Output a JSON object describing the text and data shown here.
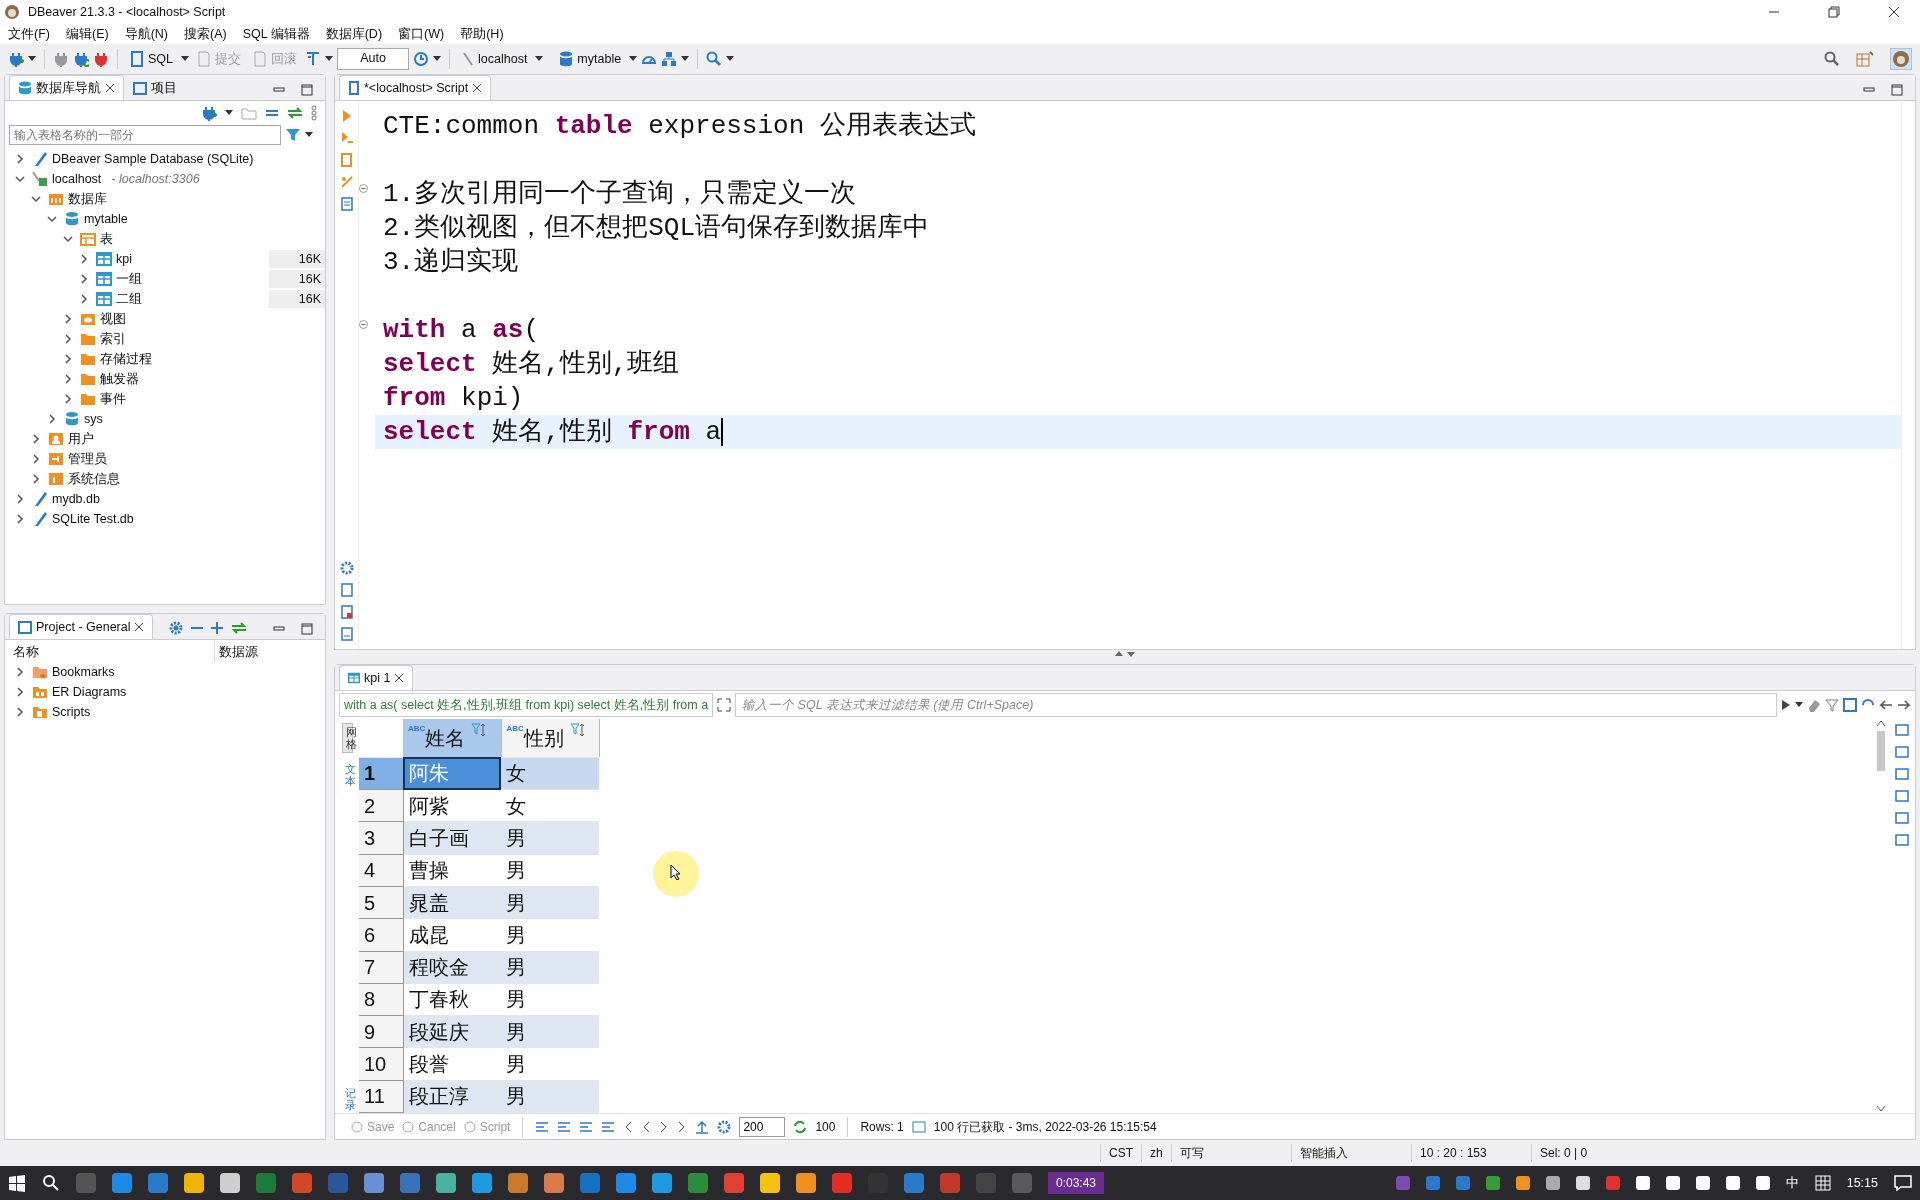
{
  "window": {
    "title": "DBeaver 21.3.3 - <localhost> Script"
  },
  "menu": [
    "文件(F)",
    "编辑(E)",
    "导航(N)",
    "搜索(A)",
    "SQL 编辑器",
    "数据库(D)",
    "窗口(W)",
    "帮助(H)"
  ],
  "toolbar": {
    "sql": "SQL",
    "commit": {
      "label": "提交",
      "disabled": true
    },
    "rollback": {
      "label": "回滚",
      "disabled": true
    },
    "mode": "Auto",
    "connection": "localhost",
    "schema": "mytable"
  },
  "navigator": {
    "tabs": [
      {
        "label": "数据库导航",
        "selected": true
      },
      {
        "label": "项目",
        "selected": false
      }
    ],
    "filter": {
      "placeholder": "输入表格名称的一部分"
    },
    "tree": [
      {
        "label": "DBeaver Sample Database (SQLite)",
        "kind": "sqlite",
        "expanded": false
      },
      {
        "label": "localhost",
        "detail": "- localhost:3306",
        "kind": "connection",
        "expanded": true,
        "children": [
          {
            "label": "数据库",
            "kind": "dbfolder",
            "expanded": true,
            "children": [
              {
                "label": "mytable",
                "kind": "database",
                "expanded": true,
                "children": [
                  {
                    "label": "表",
                    "kind": "tables",
                    "expanded": true,
                    "children": [
                      {
                        "label": "kpi",
                        "kind": "table",
                        "expanded": false,
                        "size": "16K"
                      },
                      {
                        "label": "一组",
                        "kind": "table",
                        "expanded": false,
                        "size": "16K"
                      },
                      {
                        "label": "二组",
                        "kind": "table",
                        "expanded": false,
                        "size": "16K"
                      }
                    ]
                  },
                  {
                    "label": "视图",
                    "kind": "view",
                    "expanded": false
                  },
                  {
                    "label": "索引",
                    "kind": "folder",
                    "expanded": false
                  },
                  {
                    "label": "存储过程",
                    "kind": "folder",
                    "expanded": false
                  },
                  {
                    "label": "触发器",
                    "kind": "folder",
                    "expanded": false
                  },
                  {
                    "label": "事件",
                    "kind": "folder",
                    "expanded": false
                  }
                ]
              },
              {
                "label": "sys",
                "kind": "database",
                "expanded": false
              }
            ]
          },
          {
            "label": "用户",
            "kind": "users",
            "expanded": false
          },
          {
            "label": "管理员",
            "kind": "admin",
            "expanded": false
          },
          {
            "label": "系统信息",
            "kind": "info",
            "expanded": false
          }
        ]
      },
      {
        "label": "mydb.db",
        "kind": "sqlite",
        "expanded": false
      },
      {
        "label": "SQLite Test.db",
        "kind": "sqlite",
        "expanded": false
      }
    ]
  },
  "project": {
    "title": "Project - General",
    "columns": [
      "名称",
      "数据源"
    ],
    "items": [
      {
        "label": "Bookmarks",
        "kind": "bookmarks",
        "expanded": false
      },
      {
        "label": "ER Diagrams",
        "kind": "er",
        "expanded": false
      },
      {
        "label": "Scripts",
        "kind": "scripts",
        "expanded": false
      }
    ]
  },
  "editor": {
    "tab": "*<localhost> Script",
    "lines": [
      {
        "kind": "code",
        "current": false,
        "tokens": [
          {
            "text": "CTE:common ",
            "kind": "plain"
          },
          {
            "text": "table",
            "kind": "keyword"
          },
          {
            "text": " expression 公用表表达式",
            "kind": "plain"
          }
        ]
      },
      {
        "kind": "blank"
      },
      {
        "kind": "code",
        "current": false,
        "fold": true,
        "tokens": [
          {
            "text": "1.多次引用同一个子查询，只需定义一次",
            "kind": "plain"
          }
        ]
      },
      {
        "kind": "code",
        "current": false,
        "tokens": [
          {
            "text": "2.类似视图，但不想把SQL语句保存到数据库中",
            "kind": "plain"
          }
        ]
      },
      {
        "kind": "code",
        "current": false,
        "tokens": [
          {
            "text": "3.递归实现",
            "kind": "plain"
          }
        ]
      },
      {
        "kind": "blank"
      },
      {
        "kind": "code",
        "current": false,
        "fold": true,
        "tokens": [
          {
            "text": "with",
            "kind": "keyword"
          },
          {
            "text": " a ",
            "kind": "plain"
          },
          {
            "text": "as",
            "kind": "keyword"
          },
          {
            "text": "(",
            "kind": "plain"
          }
        ]
      },
      {
        "kind": "code",
        "current": false,
        "tokens": [
          {
            "text": "select",
            "kind": "keyword"
          },
          {
            "text": " 姓名,性别,班组",
            "kind": "plain"
          }
        ]
      },
      {
        "kind": "code",
        "current": false,
        "tokens": [
          {
            "text": "from",
            "kind": "keyword"
          },
          {
            "text": " kpi)",
            "kind": "plain"
          }
        ]
      },
      {
        "kind": "code",
        "current": true,
        "tokens": [
          {
            "text": "select",
            "kind": "keyword"
          },
          {
            "text": " 姓名,性别 ",
            "kind": "plain"
          },
          {
            "text": "from",
            "kind": "keyword"
          },
          {
            "text": " a",
            "kind": "plain"
          }
        ]
      }
    ]
  },
  "results": {
    "tab": "kpi 1",
    "query": "with a as( select 姓名,性别,班组 from kpi) select 姓名,性别 from a",
    "filter": {
      "placeholder": "输入一个 SQL 表达式来过滤结果 (使用 Ctrl+Space)"
    },
    "side_tabs": [
      {
        "label": "网格",
        "selected": true
      },
      {
        "label": "文本",
        "selected": false
      }
    ],
    "side_bottom": "记录",
    "columns": [
      {
        "type": "ABC",
        "label": "姓名"
      },
      {
        "type": "ABC",
        "label": "性别"
      }
    ],
    "rows": [
      {
        "num": "1",
        "cells": [
          "阿朱",
          "女"
        ],
        "selected": true
      },
      {
        "num": "2",
        "cells": [
          "阿紫",
          "女"
        ],
        "selected": false
      },
      {
        "num": "3",
        "cells": [
          "白子画",
          "男"
        ],
        "selected": false
      },
      {
        "num": "4",
        "cells": [
          "曹操",
          "男"
        ],
        "selected": false
      },
      {
        "num": "5",
        "cells": [
          "晁盖",
          "男"
        ],
        "selected": false
      },
      {
        "num": "6",
        "cells": [
          "成昆",
          "男"
        ],
        "selected": false
      },
      {
        "num": "7",
        "cells": [
          "程咬金",
          "男"
        ],
        "selected": false
      },
      {
        "num": "8",
        "cells": [
          "丁春秋",
          "男"
        ],
        "selected": false
      },
      {
        "num": "9",
        "cells": [
          "段延庆",
          "男"
        ],
        "selected": false
      },
      {
        "num": "10",
        "cells": [
          "段誉",
          "男"
        ],
        "selected": false
      },
      {
        "num": "11",
        "cells": [
          "段正淳",
          "男"
        ],
        "selected": false
      }
    ],
    "footer": {
      "actions": [
        {
          "label": "Save",
          "disabled": true
        },
        {
          "label": "Cancel",
          "disabled": true
        },
        {
          "label": "Script",
          "disabled": true
        }
      ],
      "fetch_size": "200",
      "fetched": "100",
      "rows": "Rows: 1",
      "summary": "100 行已获取 - 3ms, 2022-03-26 15:15:54"
    }
  },
  "status_bar": [
    "CST",
    "zh",
    "可写",
    "智能插入",
    "10 : 20 : 153",
    "Sel: 0 | 0"
  ],
  "taskbar": {
    "recording": "0:03:43",
    "ime": "中",
    "time": "15:15"
  }
}
